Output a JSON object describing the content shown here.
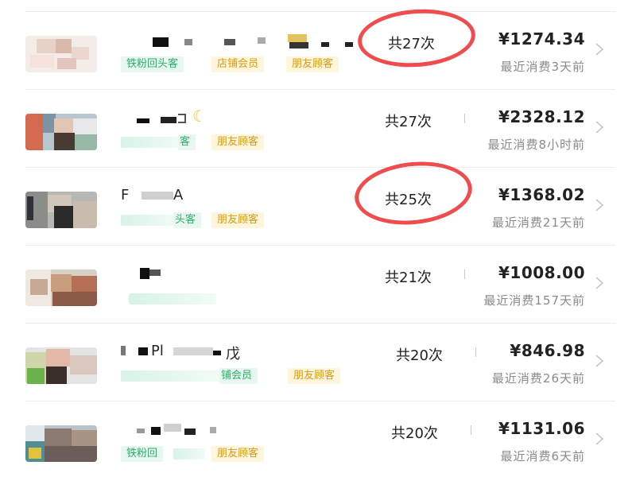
{
  "customers": [
    {
      "name": "",
      "tags": [
        "铁粉回头客",
        "店铺会员",
        "朋友顾客"
      ],
      "visit_count": "共27次",
      "amount": "¥1274.34",
      "last_purchase": "最近消费3天前",
      "highlighted": true
    },
    {
      "name": "",
      "tags": [
        "客",
        "朋友顾客"
      ],
      "visit_count": "共27次",
      "amount": "¥2328.12",
      "last_purchase": "最近消费8小时前",
      "highlighted": false
    },
    {
      "name_prefix": "F",
      "name_suffix": "A",
      "tags": [
        "头客",
        "朋友顾客"
      ],
      "visit_count": "共25次",
      "amount": "¥1368.02",
      "last_purchase": "最近消费21天前",
      "highlighted": true
    },
    {
      "name": "",
      "tags": [],
      "visit_count": "共21次",
      "amount": "¥1008.00",
      "last_purchase": "最近消费157天前",
      "highlighted": false
    },
    {
      "name_prefix": "Pl",
      "name_suffix": "戊",
      "tags": [
        "铺会员",
        "朋友顾客"
      ],
      "visit_count": "共20次",
      "amount": "¥846.98",
      "last_purchase": "最近消费26天前",
      "highlighted": false
    },
    {
      "name": "",
      "tags": [
        "铁粉回",
        "朋友顾客"
      ],
      "visit_count": "共20次",
      "amount": "¥1131.06",
      "last_purchase": "最近消费6天前",
      "highlighted": false
    }
  ],
  "colors": {
    "tag_green_text": "#2eaf6a",
    "tag_green_bg": "#e8f7ef",
    "tag_yellow_text": "#d99a18",
    "tag_yellow_bg": "#fff6dc",
    "highlight_circle": "#ef4d4d",
    "secondary_text": "#8a8a8a"
  },
  "icons": {
    "row_action": "chevron-right-icon",
    "emoji": "crescent-moon-icon"
  }
}
